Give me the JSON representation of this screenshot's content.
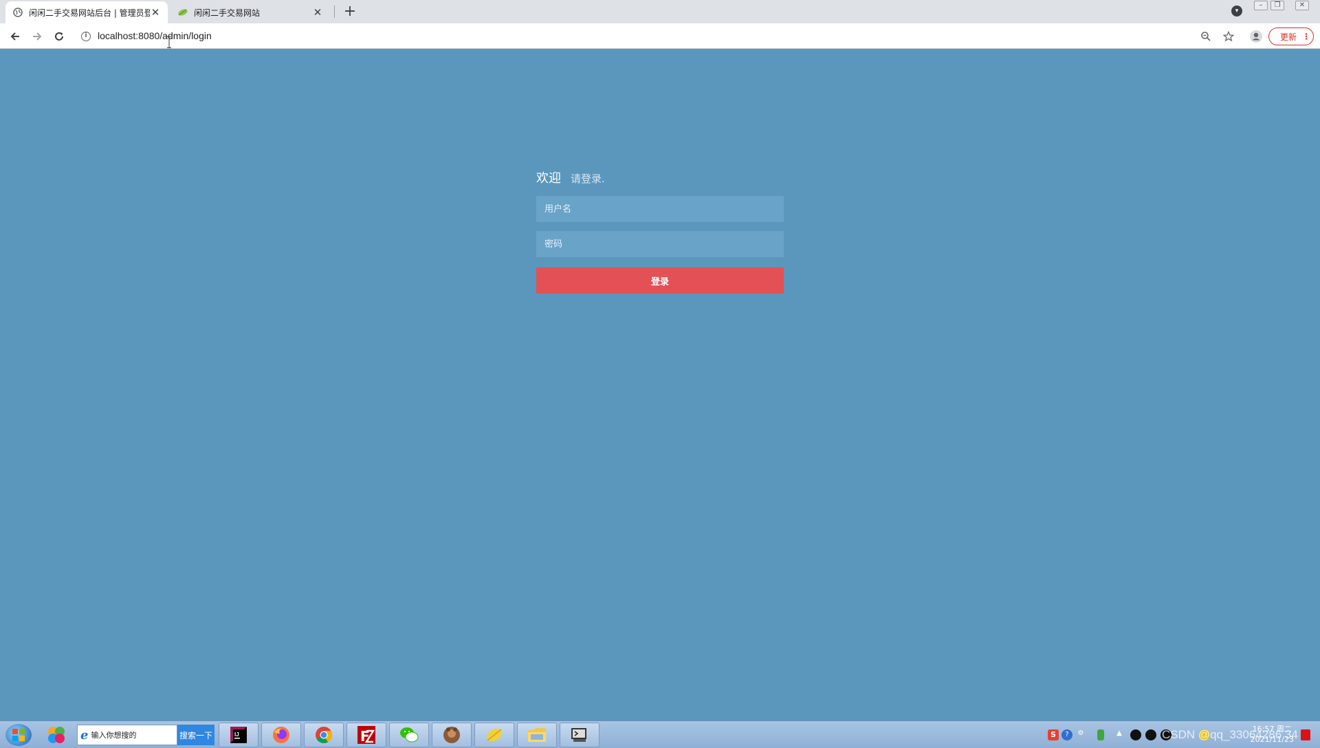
{
  "browser": {
    "tabs": [
      {
        "title": "闲闲二手交易网站后台 | 管理员登",
        "active": true
      },
      {
        "title": "闲闲二手交易网站",
        "active": false
      }
    ],
    "url": "localhost:8080/admin/login",
    "update_label": "更新"
  },
  "login": {
    "welcome": "欢迎",
    "subtitle": "请登录.",
    "username_placeholder": "用户名",
    "password_placeholder": "密码",
    "submit_label": "登录",
    "colors": {
      "background": "#5b97bd",
      "field": "#6aa3c8",
      "button": "#e35055"
    }
  },
  "taskbar": {
    "search_placeholder": "输入你想搜的",
    "search_button": "搜索一下",
    "clock_time": "16:57 周二",
    "clock_date": "2021/11/23",
    "watermark": "CSDN @qq_33064286 34"
  }
}
